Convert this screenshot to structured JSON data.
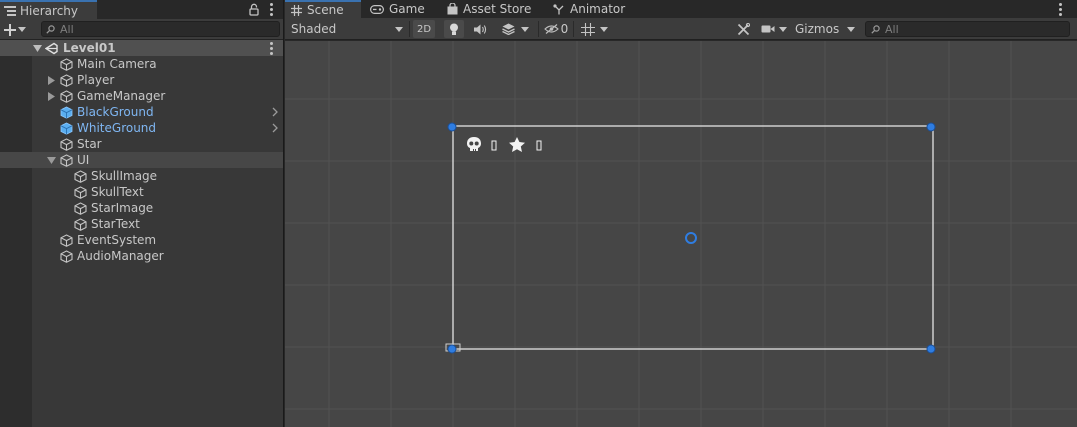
{
  "hierarchy": {
    "tab_label": "Hierarchy",
    "search_placeholder": "All",
    "scene_name": "Level01",
    "items": [
      {
        "label": "Main Camera",
        "name": "main-camera"
      },
      {
        "label": "Player",
        "name": "player"
      },
      {
        "label": "GameManager",
        "name": "gamemanager"
      },
      {
        "label": "BlackGround",
        "name": "blackground"
      },
      {
        "label": "WhiteGround",
        "name": "whiteground"
      },
      {
        "label": "Star",
        "name": "star"
      },
      {
        "label": "UI",
        "name": "ui"
      },
      {
        "label": "SkullImage",
        "name": "skullimage"
      },
      {
        "label": "SkullText",
        "name": "skulltext"
      },
      {
        "label": "StarImage",
        "name": "starimage"
      },
      {
        "label": "StarText",
        "name": "startext"
      },
      {
        "label": "EventSystem",
        "name": "eventsystem"
      },
      {
        "label": "AudioManager",
        "name": "audiomanager"
      }
    ]
  },
  "tabs": [
    {
      "label": "Scene",
      "icon": "grid-icon"
    },
    {
      "label": "Game",
      "icon": "gamepad-icon"
    },
    {
      "label": "Asset Store",
      "icon": "shopping-bag-icon"
    },
    {
      "label": "Animator",
      "icon": "animator-icon"
    }
  ],
  "toolbar": {
    "draw_mode": "Shaded",
    "mode_2d": "2D",
    "hidden_count": "0",
    "gizmos": "Gizmos",
    "search_placeholder": "All"
  },
  "colors": {
    "accent": "#3a72b0",
    "selected_text": "#7fb6f2",
    "handle": "#2f7de1",
    "viewport_bg": "#464646"
  }
}
